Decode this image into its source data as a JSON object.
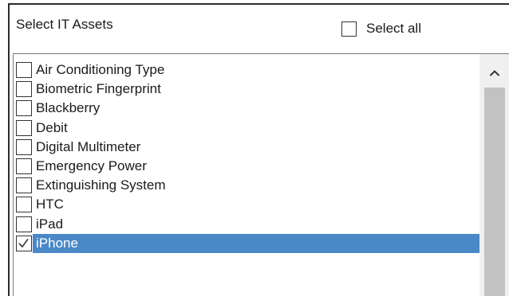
{
  "header": {
    "title": "Select IT Assets",
    "select_all_label": "Select all",
    "select_all_checked": false
  },
  "list": {
    "items": [
      {
        "label": "Air Conditioning Type",
        "checked": false,
        "selected": false
      },
      {
        "label": "Biometric Fingerprint",
        "checked": false,
        "selected": false
      },
      {
        "label": "Blackberry",
        "checked": false,
        "selected": false
      },
      {
        "label": "Debit",
        "checked": false,
        "selected": false
      },
      {
        "label": "Digital Multimeter",
        "checked": false,
        "selected": false
      },
      {
        "label": "Emergency Power",
        "checked": false,
        "selected": false
      },
      {
        "label": "Extinguishing System",
        "checked": false,
        "selected": false
      },
      {
        "label": "HTC",
        "checked": false,
        "selected": false
      },
      {
        "label": "iPad",
        "checked": false,
        "selected": false
      },
      {
        "label": "iPhone",
        "checked": true,
        "selected": true
      }
    ]
  },
  "icons": {
    "scroll_up": "chevron-up-icon",
    "check": "checkmark-icon"
  },
  "colors": {
    "selection": "#4a88c7",
    "scrollbar_track": "#f0f0f0",
    "scrollbar_thumb": "#c2c2c2"
  }
}
